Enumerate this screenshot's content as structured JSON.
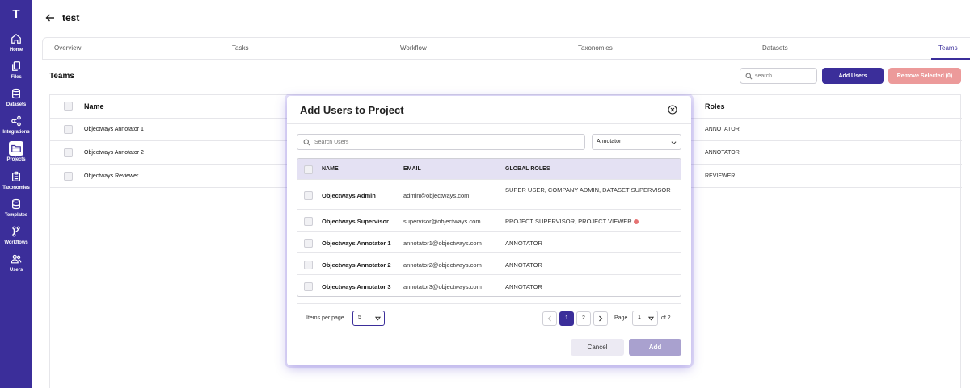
{
  "sidebar": {
    "logo": "T",
    "items": [
      {
        "label": "Home",
        "icon": "home-icon"
      },
      {
        "label": "Files",
        "icon": "files-icon"
      },
      {
        "label": "Datasets",
        "icon": "database-icon"
      },
      {
        "label": "Integrations",
        "icon": "share-icon"
      },
      {
        "label": "Projects",
        "icon": "folder-icon",
        "active": true
      },
      {
        "label": "Taxonomies",
        "icon": "clipboard-icon"
      },
      {
        "label": "Templates",
        "icon": "database-icon"
      },
      {
        "label": "Workflows",
        "icon": "branch-icon"
      },
      {
        "label": "Users",
        "icon": "users-icon"
      }
    ]
  },
  "header": {
    "title": "test"
  },
  "tabs": [
    {
      "label": "Overview"
    },
    {
      "label": "Tasks"
    },
    {
      "label": "Workflow"
    },
    {
      "label": "Taxonomies"
    },
    {
      "label": "Datasets"
    },
    {
      "label": "Teams",
      "active": true
    }
  ],
  "teams": {
    "title": "Teams",
    "search_placeholder": "search",
    "add_users_label": "Add Users",
    "remove_selected_label": "Remove Selected (0)",
    "columns": {
      "name": "Name",
      "roles": "Roles"
    },
    "rows": [
      {
        "name": "Objectways Annotator 1",
        "role": "ANNOTATOR"
      },
      {
        "name": "Objectways Annotator 2",
        "role": "ANNOTATOR"
      },
      {
        "name": "Objectways Reviewer",
        "role": "REVIEWER"
      }
    ]
  },
  "modal": {
    "title": "Add Users to Project",
    "search_placeholder": "Search Users",
    "role_filter": "Annotator",
    "columns": {
      "name": "NAME",
      "email": "EMAIL",
      "global_roles": "GLOBAL ROLES"
    },
    "rows": [
      {
        "name": "Objectways Admin",
        "email": "admin@objectways.com",
        "global_roles": "SUPER USER, COMPANY ADMIN, DATASET SUPERVISOR"
      },
      {
        "name": "Objectways Supervisor",
        "email": "supervisor@objectways.com",
        "global_roles": "PROJECT SUPERVISOR, PROJECT VIEWER"
      },
      {
        "name": "Objectways Annotator 1",
        "email": "annotator1@objectways.com",
        "global_roles": "ANNOTATOR"
      },
      {
        "name": "Objectways Annotator 2",
        "email": "annotator2@objectways.com",
        "global_roles": "ANNOTATOR"
      },
      {
        "name": "Objectways Annotator 3",
        "email": "annotator3@objectways.com",
        "global_roles": "ANNOTATOR"
      }
    ],
    "pagination": {
      "items_per_page_label": "Items per page",
      "items_per_page": "5",
      "pages": [
        "1",
        "2"
      ],
      "current_page": "1",
      "page_label": "Page",
      "page_value": "1",
      "of_label": "of 2"
    },
    "cancel_label": "Cancel",
    "add_label": "Add"
  },
  "colors": {
    "brand": "#3b2e9a",
    "danger_light": "#ec9a9a",
    "table_header": "#e4e1f3"
  }
}
